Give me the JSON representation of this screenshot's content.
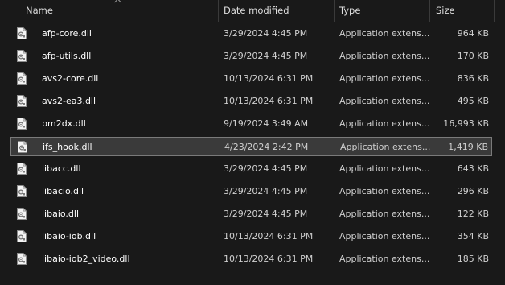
{
  "columns": {
    "name": "Name",
    "date": "Date modified",
    "type": "Type",
    "size": "Size"
  },
  "icon": "dll-file-icon",
  "files": [
    {
      "name": "afp-core.dll",
      "date": "3/29/2024 4:45 PM",
      "type": "Application extension",
      "size": "964 KB",
      "selected": false
    },
    {
      "name": "afp-utils.dll",
      "date": "3/29/2024 4:45 PM",
      "type": "Application extension",
      "size": "170 KB",
      "selected": false
    },
    {
      "name": "avs2-core.dll",
      "date": "10/13/2024 6:31 PM",
      "type": "Application extension",
      "size": "836 KB",
      "selected": false
    },
    {
      "name": "avs2-ea3.dll",
      "date": "10/13/2024 6:31 PM",
      "type": "Application extension",
      "size": "495 KB",
      "selected": false
    },
    {
      "name": "bm2dx.dll",
      "date": "9/19/2024 3:49 AM",
      "type": "Application extension",
      "size": "16,993 KB",
      "selected": false
    },
    {
      "name": "ifs_hook.dll",
      "date": "4/23/2024 2:42 PM",
      "type": "Application extension",
      "size": "1,419 KB",
      "selected": true
    },
    {
      "name": "libacc.dll",
      "date": "3/29/2024 4:45 PM",
      "type": "Application extension",
      "size": "643 KB",
      "selected": false
    },
    {
      "name": "libacio.dll",
      "date": "3/29/2024 4:45 PM",
      "type": "Application extension",
      "size": "296 KB",
      "selected": false
    },
    {
      "name": "libaio.dll",
      "date": "3/29/2024 4:45 PM",
      "type": "Application extension",
      "size": "122 KB",
      "selected": false
    },
    {
      "name": "libaio-iob.dll",
      "date": "10/13/2024 6:31 PM",
      "type": "Application extension",
      "size": "354 KB",
      "selected": false
    },
    {
      "name": "libaio-iob2_video.dll",
      "date": "10/13/2024 6:31 PM",
      "type": "Application extension",
      "size": "185 KB",
      "selected": false
    }
  ]
}
